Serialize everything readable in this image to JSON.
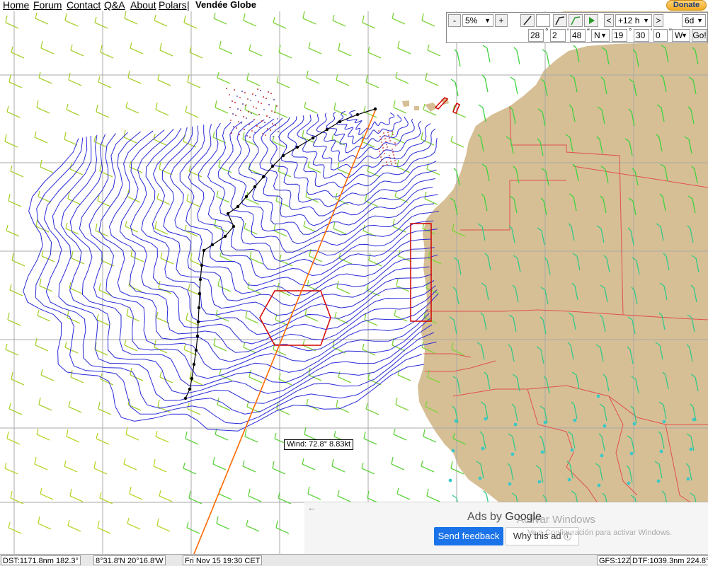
{
  "nav": {
    "links": [
      "Home",
      "Forum",
      "Contact",
      "Q&A",
      "About",
      "Polars"
    ],
    "separator": "|",
    "race_name": "Vendée Globe",
    "donate_label": "Donate"
  },
  "toolbar": {
    "zoom_minus": "-",
    "zoom_value": "5%",
    "zoom_plus": "+",
    "time_prev": "<",
    "time_step": "+12 h",
    "time_next": ">",
    "forecast_days": "6d",
    "lat_deg": "28",
    "lat_min": "2",
    "lat_sec": "48",
    "lat_hemi": "N",
    "lon_deg": "19",
    "lon_min": "30",
    "lon_sec": "0",
    "lon_hemi": "W",
    "go_label": "Go!",
    "deg_sym": "°",
    "min_sym": "'",
    "sec_sym": "\""
  },
  "map": {
    "tooltip": "Wind: 72.8° 8.83kt",
    "colors": {
      "land": "#d6bf95",
      "grid": "#a8a8a8",
      "isochrone": "#2a2ad8",
      "route": "#ff6a00",
      "zone": "#d40000",
      "border": "#e05050",
      "marker": "#3cc8c8"
    }
  },
  "ad": {
    "back_icon": "←",
    "ads_by": "Ads by",
    "brand": "Google",
    "feedback_label": "Send feedback",
    "why_label": "Why this ad",
    "info_icon": "ⓘ"
  },
  "windows_watermark": {
    "title": "Activar Windows",
    "subtitle": "Ve a Configuración para activar Windows."
  },
  "status": {
    "dst": "DST:1171.8nm 182.3°",
    "position": "8°31.8'N 20°16.8'W",
    "time": "Fri Nov 15 19:30 CET",
    "gfs": "GFS:12Z",
    "dtf": "DTF:1039.3nm 224.8°"
  }
}
